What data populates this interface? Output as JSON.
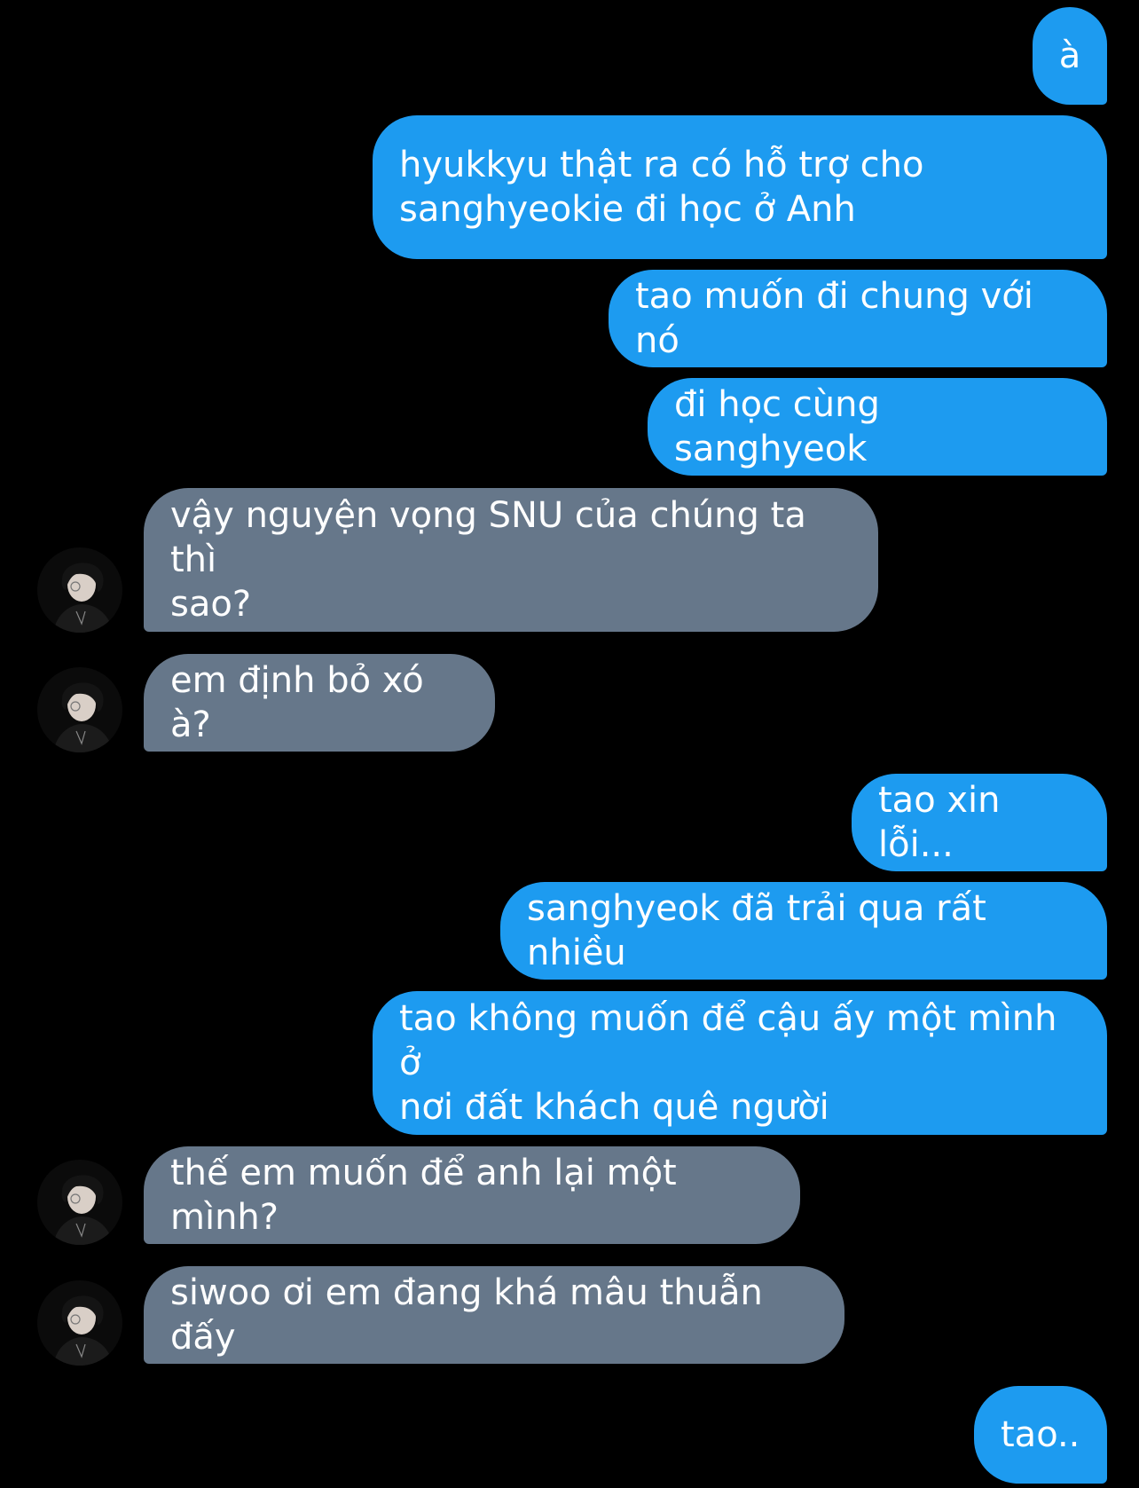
{
  "messages": [
    {
      "sender": "me",
      "text": "à"
    },
    {
      "sender": "me",
      "text": "hyukkyu thật ra có hỗ trợ cho\nsanghyeokie đi học ở Anh"
    },
    {
      "sender": "me",
      "text": "tao muốn đi chung với nó"
    },
    {
      "sender": "me",
      "text": "đi học cùng sanghyeok"
    },
    {
      "sender": "them",
      "text": "vậy nguyện vọng SNU của chúng ta thì\nsao?"
    },
    {
      "sender": "them",
      "text": "em định bỏ xó à?"
    },
    {
      "sender": "me",
      "text": "tao xin lỗi..."
    },
    {
      "sender": "me",
      "text": "sanghyeok đã trải qua rất nhiều"
    },
    {
      "sender": "me",
      "text": "tao không muốn để cậu ấy một mình ở\nnơi đất khách quê người"
    },
    {
      "sender": "them",
      "text": "thế em muốn để anh lại một mình?"
    },
    {
      "sender": "them",
      "text": "siwoo ơi em đang khá mâu thuẫn đấy"
    },
    {
      "sender": "me",
      "text": "tao.."
    }
  ],
  "colors": {
    "background": "#000000",
    "sent_bubble": "#1d9bf0",
    "received_bubble": "#66778a",
    "text": "#ffffff"
  },
  "icons": {
    "avatar": "contact-avatar-photo"
  }
}
